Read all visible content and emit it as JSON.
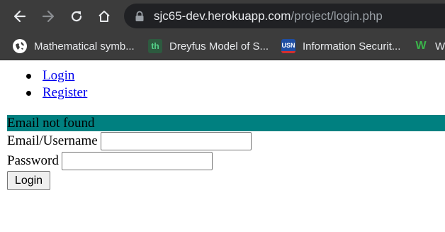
{
  "browser": {
    "address_bar": {
      "url_host": "sjc65-dev.herokuapp.com",
      "url_path": "/project/login.php"
    },
    "bookmarks": [
      {
        "label": "Mathematical symb...",
        "icon": "globe-icon"
      },
      {
        "label": "Dreyfus Model of S...",
        "icon": "th-favicon",
        "favicon_text": "th"
      },
      {
        "label": "Information Securit...",
        "icon": "usn-favicon",
        "favicon_text": "USN"
      },
      {
        "label": "W",
        "icon": "w-favicon",
        "favicon_text": "W"
      }
    ]
  },
  "page": {
    "nav": [
      {
        "label": "Login"
      },
      {
        "label": "Register"
      }
    ],
    "error_message": "Email not found",
    "form": {
      "email_label": "Email/Username",
      "email_value": "",
      "password_label": "Password",
      "password_value": "",
      "submit_label": "Login"
    }
  },
  "colors": {
    "error_background": "#008080",
    "link": "#0000ee",
    "chrome_background": "#3c3c3c",
    "omnibox_background": "#202124"
  }
}
